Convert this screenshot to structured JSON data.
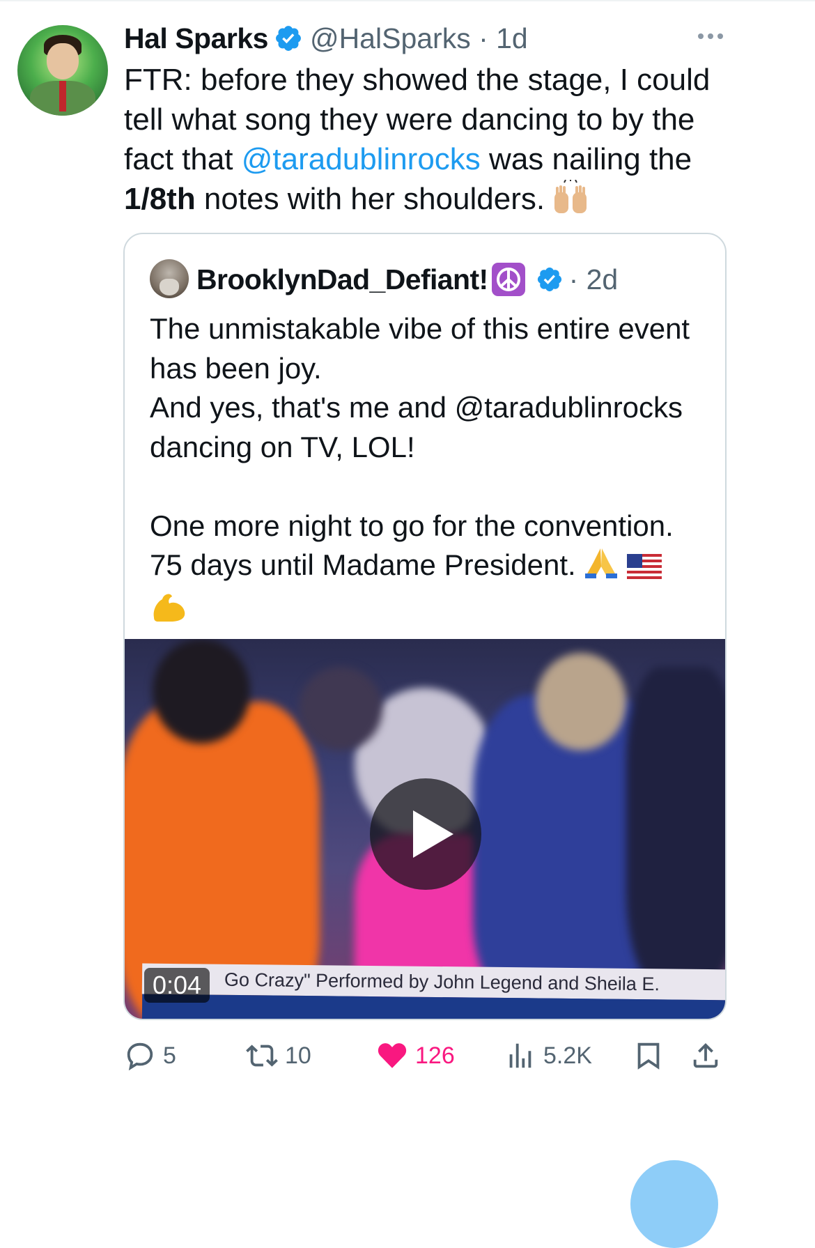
{
  "tweet": {
    "author_name": "Hal Sparks",
    "handle_time": "@HalSparks · 1d",
    "text_1": "FTR: before they showed the stage, I could tell what song they were dancing to by the fact that ",
    "mention": "@taradublinrocks",
    "text_2": " was nailing the ",
    "bold": "1/8th",
    "text_3": " notes with her shoulders."
  },
  "quote": {
    "author_name": "BrooklynDad_Defiant!",
    "time": "· 2d",
    "text": "The unmistakable vibe of this entire event has been joy.\nAnd yes, that's me and @taradublinrocks dancing on TV, LOL!\n\nOne more night to go for the convention.\n75 days until Madame President. ",
    "video": {
      "duration": "0:04",
      "caption": "Go Crazy\" Performed by John Legend and Sheila E."
    }
  },
  "actions": {
    "replies": "5",
    "reposts": "10",
    "likes": "126",
    "views": "5.2K"
  },
  "icons": [
    "verified-icon",
    "more-icon",
    "reply-icon",
    "repost-icon",
    "like-icon",
    "views-icon",
    "bookmark-icon",
    "share-icon",
    "play-icon"
  ],
  "colors": {
    "accent": "#1d9bf0",
    "like": "#f91880",
    "muted": "#536471",
    "text": "#0f1419"
  }
}
